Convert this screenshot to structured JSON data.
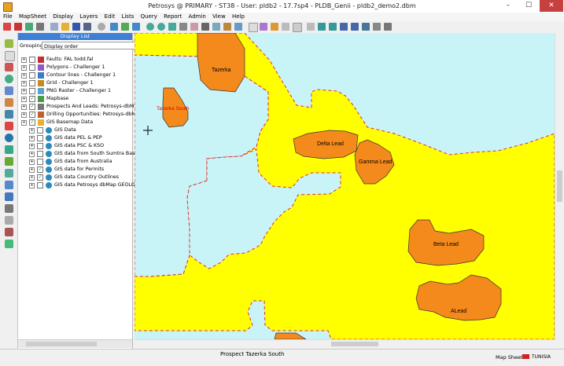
{
  "window": {
    "title": "Petrosys @ PRIMARY - ST38 - User: pldb2 - 17.7sp4 - PLDB_Genii - pldb2_demo2.dbm",
    "minimize": "–",
    "maximize": "☐",
    "close": "✕"
  },
  "menu": [
    "File",
    "MapSheet",
    "Display",
    "Layers",
    "Edit",
    "Lists",
    "Query",
    "Report",
    "Admin",
    "View",
    "Help"
  ],
  "display_list": {
    "header": "Display List",
    "grouping_label": "Grouping",
    "grouping_value": "Display order",
    "layers": [
      {
        "label": "Faults: FAL todd.fal",
        "checked": false,
        "icon": "fault-icon"
      },
      {
        "label": "Polygons - Challenger 1",
        "checked": false,
        "icon": "polygon-icon"
      },
      {
        "label": "Contour lines - Challenger 1",
        "checked": false,
        "icon": "contour-icon"
      },
      {
        "label": "Grid - Challenger 1",
        "checked": false,
        "icon": "grid-icon"
      },
      {
        "label": "PNG Raster - Challenger 1",
        "checked": false,
        "icon": "raster-icon"
      },
      {
        "label": "Mapbase",
        "checked": true,
        "icon": "mapbase-icon"
      },
      {
        "label": "Prospects And Leads: Petrosys-dbMap",
        "checked": true,
        "icon": "prospect-icon"
      },
      {
        "label": "Drilling Opportunities: Petrosys-dbMap",
        "checked": true,
        "icon": "drilling-icon"
      },
      {
        "label": "GIS Basemap Data",
        "checked": true,
        "icon": "folder-icon"
      },
      {
        "label": "GIS Data",
        "checked": false,
        "icon": "gis-icon"
      },
      {
        "label": "GIS data PEL & PEP",
        "checked": false,
        "icon": "gis-icon"
      },
      {
        "label": "GIS data PSC & KSO",
        "checked": false,
        "icon": "gis-icon"
      },
      {
        "label": "GIS data from South Sumtra Basin",
        "checked": false,
        "icon": "gis-icon"
      },
      {
        "label": "GIS data from Australia",
        "checked": false,
        "icon": "gis-icon"
      },
      {
        "label": "GIS data for Permits",
        "checked": true,
        "icon": "gis-icon"
      },
      {
        "label": "GIS data Country Outlines",
        "checked": true,
        "icon": "gis-icon"
      },
      {
        "label": "GIS data Petrosys dbMap GEOLOG",
        "checked": false,
        "icon": "gis-icon"
      }
    ]
  },
  "map": {
    "labels": [
      "Tazerka",
      "Tazerka South",
      "Delta Lead",
      "Gamma Lead",
      "Beta Lead",
      "ALead"
    ],
    "colors": {
      "sea": "#c8f4f8",
      "land": "#ffff00",
      "prospect": "#f58a1c",
      "boundary": "#e03030",
      "highlight_label": "#e00000"
    }
  },
  "status": {
    "message": "Prospect Tazerka South",
    "mode": "Map Sheet",
    "region": "TUNISIA"
  }
}
